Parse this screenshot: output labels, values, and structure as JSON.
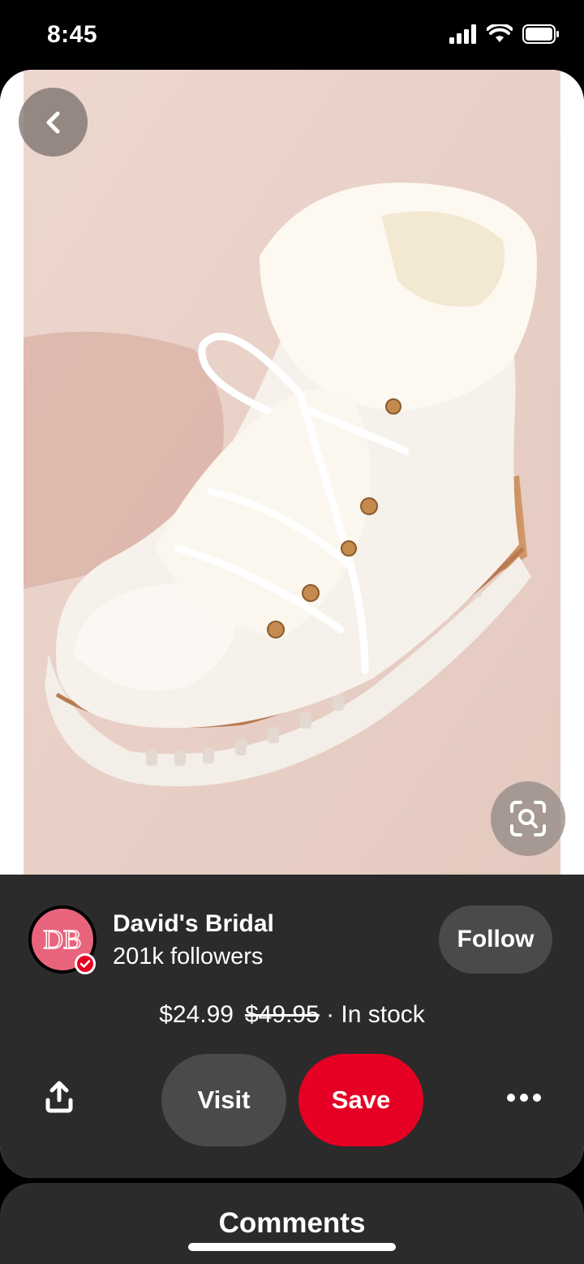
{
  "status_bar": {
    "time": "8:45",
    "icons": [
      "cellular-signal-icon",
      "wifi-icon",
      "battery-icon"
    ]
  },
  "pin": {
    "image_description_icon": "white-fur-lined-hiking-boot",
    "back_icon": "chevron-left-icon",
    "lens_icon": "visual-search-icon"
  },
  "creator": {
    "name": "David's Bridal",
    "followers": "201k followers",
    "avatar_text": "DB",
    "follow_label": "Follow"
  },
  "product": {
    "price": "$24.99",
    "original_price": "$49.95",
    "availability": "· In stock"
  },
  "actions": {
    "share_icon": "share-icon",
    "visit_label": "Visit",
    "save_label": "Save",
    "more_icon": "more-horizontal-icon"
  },
  "comments": {
    "title": "Comments"
  },
  "colors": {
    "save_red": "#e60023",
    "panel_bg": "#2b2b2b",
    "button_gray": "#4a4a4a",
    "image_bg": "#ecd5cd"
  }
}
